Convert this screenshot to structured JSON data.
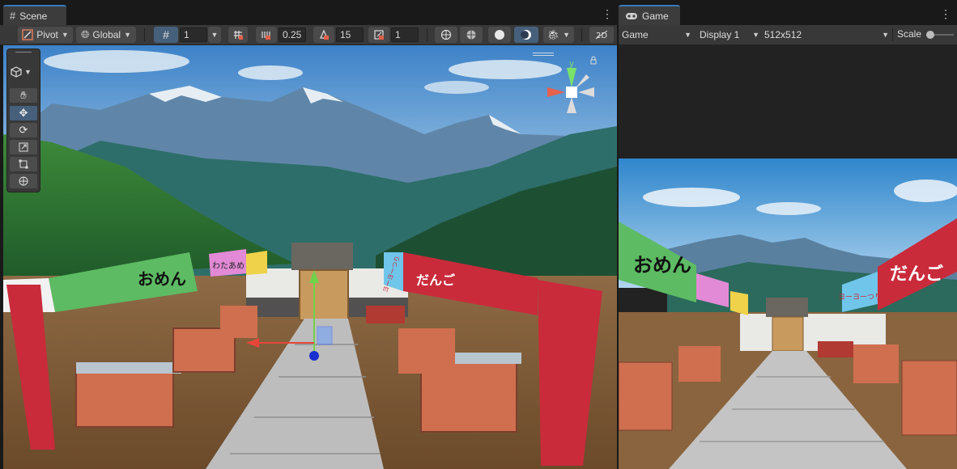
{
  "scene_panel": {
    "tab_label": "Scene",
    "tab_icon": "grid-hash-icon",
    "toolbar": {
      "pivot_label": "Pivot",
      "global_label": "Global",
      "grid_value": "1",
      "snap_increment": "0.25",
      "rotate_snap": "15",
      "scale_snap": "1"
    }
  },
  "game_panel": {
    "tab_label": "Game",
    "tab_icon": "gamepad-icon",
    "toolbar": {
      "mode": "Game",
      "display": "Display 1",
      "resolution": "512x512",
      "scale_label": "Scale"
    }
  },
  "gizmo": {
    "y_axis_label": "y"
  },
  "stalls": {
    "left_front_sign": "おめん",
    "left_mid_sign": "わたあめ",
    "right_front_sign": "だんご",
    "right_side_sign": "ヨーヨーつり"
  },
  "colors": {
    "accent_blue": "#3a79bb",
    "active_tool": "#46607c",
    "green_awning": "#5dbb63",
    "red_awning": "#c92b3b"
  }
}
